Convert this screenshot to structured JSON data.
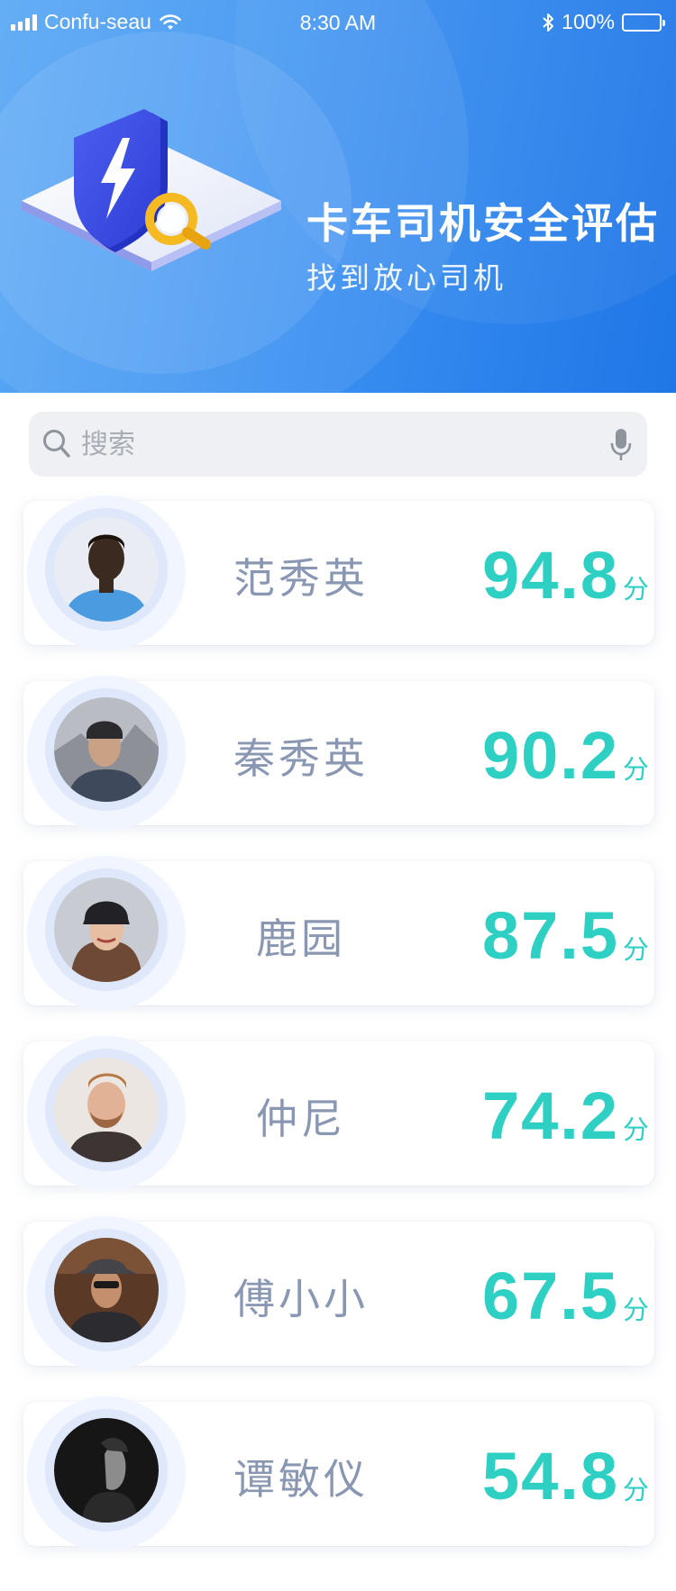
{
  "status_bar": {
    "carrier": "Confu-seau",
    "time": "8:30 AM",
    "battery": "100%"
  },
  "header": {
    "title": "卡车司机安全评估",
    "subtitle": "找到放心司机",
    "illustration_icon": "shield-magnifier-icon"
  },
  "search": {
    "placeholder": "搜索",
    "value": ""
  },
  "score_unit": "分",
  "drivers": [
    {
      "name": "范秀英",
      "score": "94.8"
    },
    {
      "name": "秦秀英",
      "score": "90.2"
    },
    {
      "name": "鹿园",
      "score": "87.5"
    },
    {
      "name": "仲尼",
      "score": "74.2"
    },
    {
      "name": "傅小小",
      "score": "67.5"
    },
    {
      "name": "谭敏仪",
      "score": "54.8"
    }
  ],
  "colors": {
    "header_gradient_start": "#5aa8f5",
    "header_gradient_end": "#1f76e6",
    "score": "#2fd0c4",
    "name": "#8a97b3",
    "shield": "#3d4ee6",
    "magnifier": "#f5b922"
  }
}
